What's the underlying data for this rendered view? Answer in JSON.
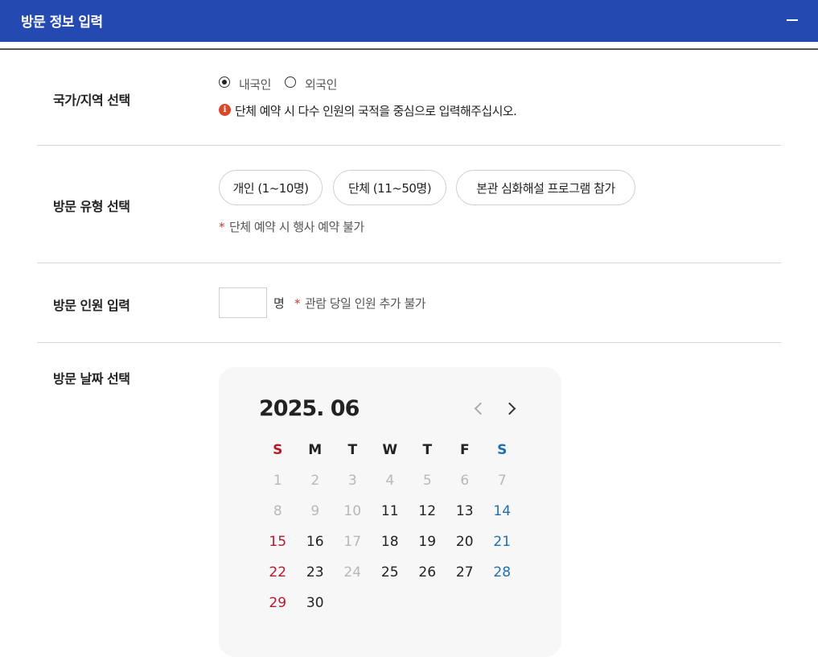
{
  "header": {
    "title": "방문 정보 입력"
  },
  "nationality": {
    "label": "국가/지역 선택",
    "options": [
      {
        "label": "내국인",
        "selected": true
      },
      {
        "label": "외국인",
        "selected": false
      }
    ],
    "info": "단체 예약 시 다수 인원의 국적을 중심으로 입력해주십시오.",
    "info_icon": "i"
  },
  "visit_type": {
    "label": "방문 유형 선택",
    "options": [
      "개인 (1~10명)",
      "단체 (11~50명)",
      "본관 심화해설 프로그램 참가"
    ],
    "note_star": "*",
    "note": "단체 예약 시 행사 예약 불가"
  },
  "visitor_count": {
    "label": "방문 인원 입력",
    "value": "",
    "unit": "명",
    "note_star": "*",
    "note": "관람 당일 인원 추가 불가"
  },
  "visit_date": {
    "label": "방문 날짜 선택",
    "calendar": {
      "month_label": "2025. 06",
      "weekdays": [
        "S",
        "M",
        "T",
        "W",
        "T",
        "F",
        "S"
      ],
      "weeks": [
        [
          "1",
          "2",
          "3",
          "4",
          "5",
          "6",
          "7"
        ],
        [
          "8",
          "9",
          "10",
          "11",
          "12",
          "13",
          "14"
        ],
        [
          "15",
          "16",
          "17",
          "18",
          "19",
          "20",
          "21"
        ],
        [
          "22",
          "23",
          "24",
          "25",
          "26",
          "27",
          "28"
        ],
        [
          "29",
          "30"
        ]
      ],
      "disabled_days": [
        "1",
        "2",
        "3",
        "4",
        "5",
        "6",
        "7",
        "8",
        "9",
        "10",
        "17",
        "24"
      ]
    }
  },
  "colors": {
    "header_bg": "#2449b0",
    "sunday": "#b8172a",
    "saturday": "#1f6fae",
    "info_icon": "#d9482b"
  }
}
